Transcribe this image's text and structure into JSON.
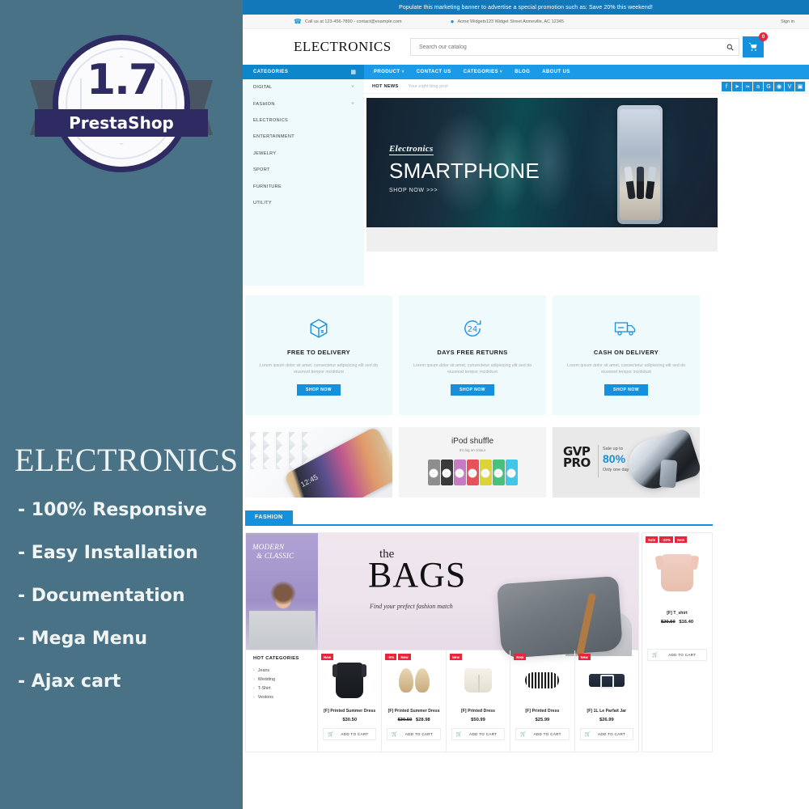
{
  "promo_panel": {
    "badge": {
      "version": "1.7",
      "name": "PrestaShop"
    },
    "title": "ELECTRONICS",
    "features": [
      "- 100% Responsive",
      "- Easy Installation",
      "- Documentation",
      "- Mega Menu",
      "- Ajax cart"
    ]
  },
  "colors": {
    "panel_bg": "#4a7287",
    "accent_blue": "#1490dd",
    "nav_blue": "#1b9ae8",
    "sale_red": "#e8253a",
    "badge_navy": "#2e2b62",
    "service_bg": "#effafc"
  },
  "shop": {
    "marketing_banner": "Populate this marketing banner to advertise a special promotion such as: Save 20% this weekend!",
    "contact_bar": {
      "phone_icon": "phone-icon",
      "phone": "Call us at 123-456-7890 - contact@example.com",
      "location_icon": "map-pin-icon",
      "address": "Acme Widgets123 Widget Street Acmeville, AC 12345",
      "signin": "Sign in"
    },
    "header": {
      "logo": "ELECTRONICS",
      "search_placeholder": "Search our catalog",
      "search_value": "",
      "search_icon": "search-icon",
      "cart_icon": "shopping-cart-icon",
      "cart_count": "0"
    },
    "nav": {
      "categories_label": "CATEGORIES",
      "categories_icon": "grid-menu-icon",
      "items": [
        {
          "label": "PRODUCT",
          "caret": "˅"
        },
        {
          "label": "CONTACT US",
          "caret": ""
        },
        {
          "label": "CATEGORIES",
          "caret": "˅"
        },
        {
          "label": "BLOG",
          "caret": ""
        },
        {
          "label": "ABOUT US",
          "caret": ""
        }
      ]
    },
    "sidebar": {
      "items": [
        {
          "label": "DIGITAL",
          "caret": "˅"
        },
        {
          "label": "FASHION",
          "caret": "˅"
        },
        {
          "label": "ELECTRONICS",
          "caret": ""
        },
        {
          "label": "ENTERTAINMENT",
          "caret": ""
        },
        {
          "label": "JEWELRY",
          "caret": ""
        },
        {
          "label": "SPORT",
          "caret": ""
        },
        {
          "label": "FURNITURE",
          "caret": ""
        },
        {
          "label": "UTILITY",
          "caret": ""
        }
      ]
    },
    "hot_news": {
      "label": "HOT NEWS",
      "text": "Your eight blog post",
      "social": [
        {
          "name": "facebook-icon",
          "glyph": "f"
        },
        {
          "name": "twitter-icon",
          "glyph": "➤"
        },
        {
          "name": "rss-icon",
          "glyph": "≈"
        },
        {
          "name": "amazon-icon",
          "glyph": "a"
        },
        {
          "name": "google-plus-icon",
          "glyph": "G"
        },
        {
          "name": "pinterest-icon",
          "glyph": "◉"
        },
        {
          "name": "vimeo-icon",
          "glyph": "V"
        },
        {
          "name": "instagram-icon",
          "glyph": "▣"
        }
      ]
    },
    "hero": {
      "eyebrow": "Electronics",
      "title": "SMARTPHONE",
      "cta": "SHOP NOW >>>"
    },
    "services": [
      {
        "icon": "package-box-icon",
        "title": "FREE TO DELIVERY",
        "text": "Lorem ipsum dolor sit amet, consectetur adipisicing elit sed do eiusmod tempor incididunt",
        "button": "SHOP NOW"
      },
      {
        "icon": "24-hours-return-icon",
        "title": "DAYS FREE RETURNS",
        "text": "Lorem ipsum dolor sit amet, consectetur adipisicing elit sed do eiusmod tempor incididunt",
        "button": "SHOP NOW"
      },
      {
        "icon": "delivery-truck-icon",
        "title": "CASH ON DELIVERY",
        "text": "Lorem ipsum dolor sit amet, consectetur adipisicing elit sed do eiusmod tempor incididunt",
        "button": "SHOP NOW"
      }
    ],
    "promo_banners": {
      "banner1": {
        "name": "smartphone-banner",
        "text": "12:45"
      },
      "banner2": {
        "title": "iPod shuffle",
        "subtitle": "It's big on colour",
        "swatch_colors": [
          "#8e8e8e",
          "#3a3a3a",
          "#c87bc4",
          "#e8505b",
          "#dbd434",
          "#48c07e",
          "#3fc6e8"
        ]
      },
      "banner3": {
        "brand_line1": "GVP",
        "brand_line2": "PRO",
        "sale_top": "Sale up to",
        "sale_pct": "80%",
        "sale_bottom": "Only one day"
      }
    },
    "fashion": {
      "tab": "FASHION",
      "banner": {
        "left_line1": "MODERN",
        "left_line2": "& CLASSIC",
        "the": "the",
        "bags": "BAGS",
        "tagline": "Find your prefect fashion match"
      },
      "hot_categories": {
        "title": "HOT CATEGORIES",
        "items": [
          "Jeans",
          "Wedding",
          "T-Shirt",
          "Vestons"
        ]
      },
      "featured_product": {
        "badges": [
          "Sale",
          "-20%",
          "New"
        ],
        "thumb": "tshirt-thumb",
        "name": "[F] T_shirt",
        "old_price": "$20.50",
        "price": "$16.40",
        "add_to_cart": "ADD TO CART",
        "cart_icon": "cart-icon"
      },
      "products": [
        {
          "badges": [
            "New"
          ],
          "thumb": "dress-thumb",
          "name": "[F] Printed Summer Dress",
          "old_price": "",
          "price": "$30.50",
          "add_to_cart": "ADD TO CART",
          "cart_icon": "cart-icon"
        },
        {
          "badges": [
            "-5%",
            "New"
          ],
          "thumb": "shoes-thumb",
          "name": "[F] Printed Summer Dress",
          "old_price": "$30.50",
          "price": "$28.98",
          "add_to_cart": "ADD TO CART",
          "cart_icon": "cart-icon"
        },
        {
          "badges": [
            "New"
          ],
          "thumb": "shorts-thumb",
          "name": "[F] Printed Dress",
          "old_price": "",
          "price": "$50.99",
          "add_to_cart": "ADD TO CART",
          "cart_icon": "cart-icon"
        },
        {
          "badges": [
            "New"
          ],
          "thumb": "bracelet-thumb",
          "name": "[F] Printed Dress",
          "old_price": "",
          "price": "$25.99",
          "add_to_cart": "ADD TO CART",
          "cart_icon": "cart-icon"
        },
        {
          "badges": [
            "New"
          ],
          "thumb": "belt-thumb",
          "name": "[F] 1L Le Parfait Jar",
          "old_price": "",
          "price": "$26.99",
          "add_to_cart": "ADD TO CART",
          "cart_icon": "cart-icon"
        }
      ]
    }
  }
}
